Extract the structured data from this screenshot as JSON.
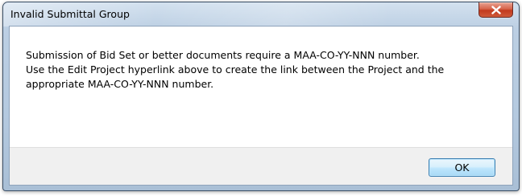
{
  "dialog": {
    "title": "Invalid Submittal Group",
    "message_lines": [
      "Submission of Bid Set or better documents require a MAA-CO-YY-NNN number.",
      "Use the Edit Project hyperlink above to create the link between the Project and the",
      "appropriate MAA-CO-YY-NNN number."
    ],
    "ok_label": "OK",
    "close_icon": "close-icon"
  },
  "colors": {
    "close_button": "#c7432a",
    "title_bar": "#bccfe3",
    "ok_button_border": "#3c7fb1"
  }
}
